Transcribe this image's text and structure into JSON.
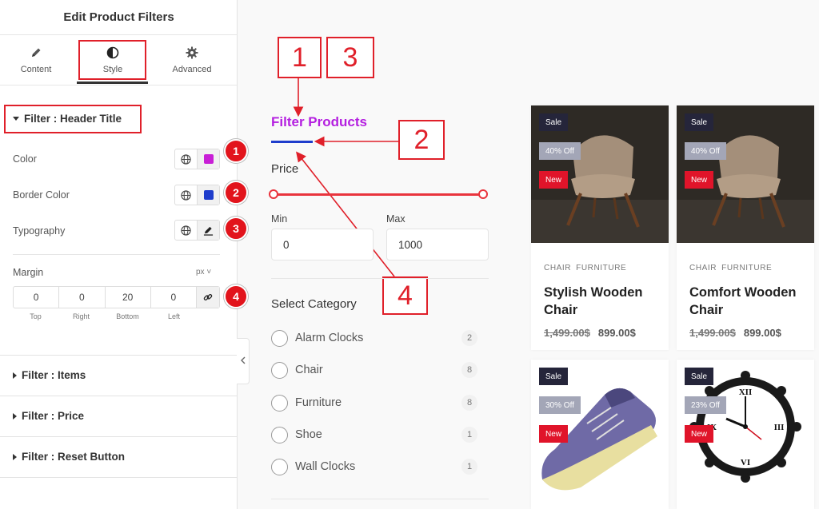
{
  "panel": {
    "title": "Edit Product Filters",
    "tabs": [
      {
        "label": "Content",
        "icon": "pencil-icon"
      },
      {
        "label": "Style",
        "icon": "contrast-icon"
      },
      {
        "label": "Advanced",
        "icon": "gear-icon"
      }
    ],
    "active_tab": "Style",
    "header_section": {
      "title": "Filter : Header Title",
      "controls": [
        {
          "label": "Color",
          "value_color": "#c81fd6",
          "badge": "1"
        },
        {
          "label": "Border Color",
          "value_color": "#1f3dcc",
          "badge": "2"
        },
        {
          "label": "Typography",
          "badge": "3"
        }
      ],
      "margin": {
        "label": "Margin",
        "unit": "px",
        "values": [
          "0",
          "0",
          "20",
          "0"
        ],
        "captions": [
          "Top",
          "Right",
          "Bottom",
          "Left"
        ],
        "badge": "4"
      }
    },
    "collapsed_sections": [
      "Filter : Items",
      "Filter : Price",
      "Filter : Reset Button"
    ]
  },
  "callouts": [
    "1",
    "3",
    "2",
    "4"
  ],
  "filter": {
    "title": "Filter Products",
    "title_color": "#b41fe0",
    "underline_color": "#1f3dcc",
    "price_label": "Price",
    "min_label": "Min",
    "max_label": "Max",
    "min_value": "0",
    "max_value": "1000",
    "category_label": "Select Category",
    "categories": [
      {
        "name": "Alarm Clocks",
        "count": "2"
      },
      {
        "name": "Chair",
        "count": "8"
      },
      {
        "name": "Furniture",
        "count": "8"
      },
      {
        "name": "Shoe",
        "count": "1"
      },
      {
        "name": "Wall Clocks",
        "count": "1"
      }
    ]
  },
  "products": [
    {
      "sale": "Sale",
      "discount": "40% Off",
      "new": "New",
      "cats": [
        "CHAIR",
        "FURNITURE"
      ],
      "name": "Stylish Wooden Chair",
      "old_price": "1,499.00$",
      "price": "899.00$"
    },
    {
      "sale": "Sale",
      "discount": "40% Off",
      "new": "New",
      "cats": [
        "CHAIR",
        "FURNITURE"
      ],
      "name": "Comfort Wooden Chair",
      "old_price": "1,499.00$",
      "price": "899.00$"
    },
    {
      "sale": "Sale",
      "discount": "30% Off",
      "new": "New"
    },
    {
      "sale": "Sale",
      "discount": "23% Off",
      "new": "New"
    }
  ],
  "colors": {
    "accent_red": "#e0202a",
    "badge_red": "#e2141c"
  }
}
